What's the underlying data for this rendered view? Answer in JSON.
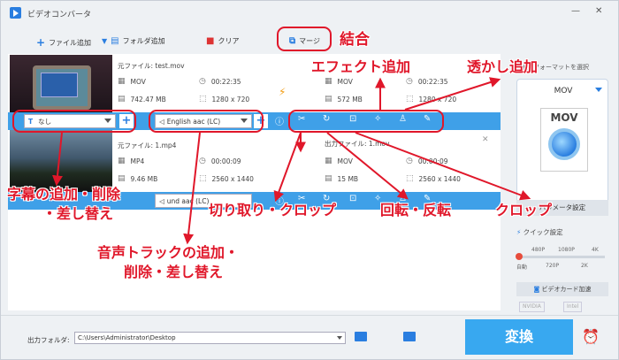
{
  "app": {
    "title": "ビデオコンバータ"
  },
  "toolbar": {
    "add_file": "ファイル追加",
    "add_folder": "フォルダ追加",
    "clear": "クリア",
    "merge": "マージ"
  },
  "files": [
    {
      "source": "元ファイル: test.mov",
      "format": "MOV",
      "duration": "00:22:35",
      "size": "742.47 MB",
      "resolution": "1280 x 720",
      "out_format": "MOV",
      "out_duration": "00:22:35",
      "out_size": "572 MB",
      "out_resolution": "1280 x 720",
      "subtitle": "なし",
      "audio": "English aac (LC)"
    },
    {
      "source": "元ファイル: 1.mp4",
      "format": "MP4",
      "duration": "00:00:09",
      "size": "9.46 MB",
      "resolution": "2560 x 1440",
      "out_label": "出力ファイル: 1.mov",
      "out_format": "MOV",
      "out_duration": "00:00:09",
      "out_size": "15 MB",
      "out_resolution": "2560 x 1440",
      "audio": "und aac (LC)"
    }
  ],
  "right_panel": {
    "select_hint": "出力フォーマットを選択",
    "format": "MOV",
    "param_settings": "パラメータ設定",
    "quick_settings": "クイック設定",
    "quality_top": [
      "480P",
      "1080P",
      "4K"
    ],
    "quality_bottom": [
      "自動",
      "720P",
      "2K"
    ],
    "gpu_accel": "ビデオカード加速",
    "gpu_vendors": [
      "NVIDIA",
      "Intel"
    ]
  },
  "bottom": {
    "output_folder_label": "出力フォルダ:",
    "output_path": "C:\\Users\\Administrator\\Desktop",
    "convert": "変換"
  },
  "annotations": {
    "merge": "結合",
    "effect": "エフェクト追加",
    "watermark": "透かし追加",
    "subtitle_1": "字幕の追加・削除",
    "subtitle_2": "・差し替え",
    "cut": "切り取り・クロップ",
    "rotate": "回転・反転",
    "crop": "クロップ",
    "audio_1": "音声トラックの追加・",
    "audio_2": "削除・差し替え"
  },
  "colors": {
    "accent": "#2a7ee0",
    "bar": "#3fa0e8",
    "annotation": "#e0172a"
  }
}
